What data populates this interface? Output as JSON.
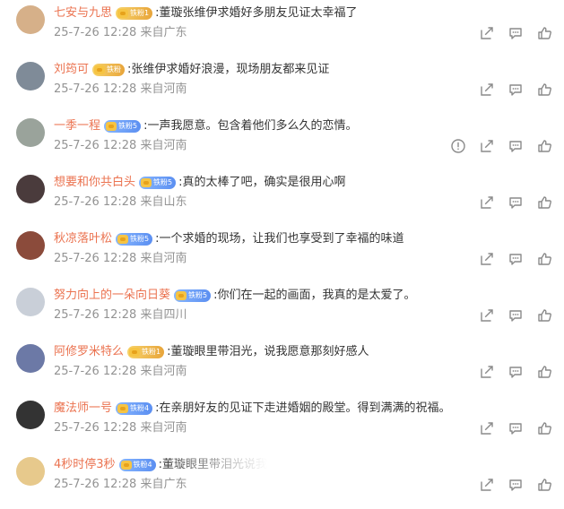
{
  "comments": [
    {
      "username": "七安与九思",
      "badge": "铁粉1",
      "badge_style": "gold",
      "text": ":董璇张维伊求婚好多朋友见证太幸福了",
      "meta": "25-7-26 12:28 来自广东",
      "report": false,
      "fade": false,
      "avatar_color": "#d6b089"
    },
    {
      "username": "刘筠可",
      "badge": "铁粉",
      "badge_style": "gold",
      "text": ":张维伊求婚好浪漫，现场朋友都来见证",
      "meta": "25-7-26 12:28 来自河南",
      "report": false,
      "fade": false,
      "avatar_color": "#7f8b98"
    },
    {
      "username": "一季一程",
      "badge": "铁粉5",
      "badge_style": "blue",
      "text": ":一声我愿意。包含着他们多么久的恋情。",
      "meta": "25-7-26 12:28 来自河南",
      "report": true,
      "fade": false,
      "avatar_color": "#9aa39b"
    },
    {
      "username": "想要和你共白头",
      "badge": "铁粉5",
      "badge_style": "blue",
      "text": ":真的太棒了吧，确实是很用心啊",
      "meta": "25-7-26 12:28 来自山东",
      "report": false,
      "fade": false,
      "avatar_color": "#4a3b3c"
    },
    {
      "username": "秋凉落叶松",
      "badge": "铁粉5",
      "badge_style": "blue",
      "text": ":一个求婚的现场，让我们也享受到了幸福的味道",
      "meta": "25-7-26 12:28 来自河南",
      "report": false,
      "fade": false,
      "avatar_color": "#8b4b3b"
    },
    {
      "username": "努力向上的一朵向日葵",
      "badge": "铁粉5",
      "badge_style": "blue",
      "text": ":你们在一起的画面，我真的是太爱了。",
      "meta": "25-7-26 12:28 来自四川",
      "report": false,
      "fade": false,
      "avatar_color": "#c9cfd8"
    },
    {
      "username": "阿修罗米特么",
      "badge": "铁粉1",
      "badge_style": "gold",
      "text": ":董璇眼里带泪光，说我愿意那刻好感人",
      "meta": "25-7-26 12:28 来自河南",
      "report": false,
      "fade": false,
      "avatar_color": "#6c79a6"
    },
    {
      "username": "魔法师一号",
      "badge": "铁粉4",
      "badge_style": "blue",
      "text": ":在亲朋好友的见证下走进婚姻的殿堂。得到满满的祝福。",
      "meta": "25-7-26 12:28 来自河南",
      "report": false,
      "fade": false,
      "avatar_color": "#333333"
    },
    {
      "username": "4秒时停3秒",
      "badge": "铁粉4",
      "badge_style": "blue",
      "text": ":董璇眼里带泪光说我",
      "meta": "25-7-26 12:28 来自广东",
      "report": false,
      "fade": true,
      "avatar_color": "#e7c98c"
    }
  ],
  "icons": {
    "share": "share-icon",
    "comment": "comment-icon",
    "like": "like-icon",
    "report": "report-icon"
  }
}
